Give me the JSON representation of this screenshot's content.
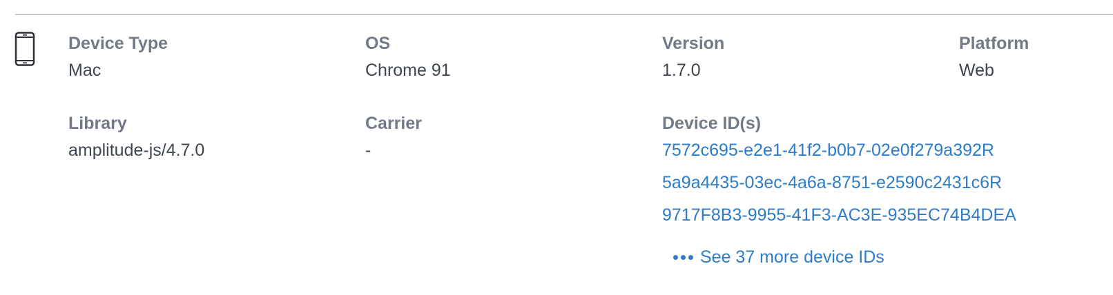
{
  "device": {
    "icon": "mobile-phone-icon",
    "fields": {
      "device_type": {
        "label": "Device Type",
        "value": "Mac"
      },
      "os": {
        "label": "OS",
        "value": "Chrome 91"
      },
      "version": {
        "label": "Version",
        "value": "1.7.0"
      },
      "platform": {
        "label": "Platform",
        "value": "Web"
      },
      "library": {
        "label": "Library",
        "value": "amplitude-js/4.7.0"
      },
      "carrier": {
        "label": "Carrier",
        "value": "-"
      }
    },
    "device_ids": {
      "label": "Device ID(s)",
      "ids": [
        "7572c695-e2e1-41f2-b0b7-02e0f279a392R",
        "5a9a4435-03ec-4a6a-8751-e2590c2431c6R",
        "9717F8B3-9955-41F3-AC3E-935EC74B4DEA"
      ],
      "more_label": "See 37 more device IDs"
    },
    "colors": {
      "label": "#717a85",
      "value": "#3e4650",
      "link": "#2e7cc8",
      "divider": "#c8ccd2"
    }
  }
}
